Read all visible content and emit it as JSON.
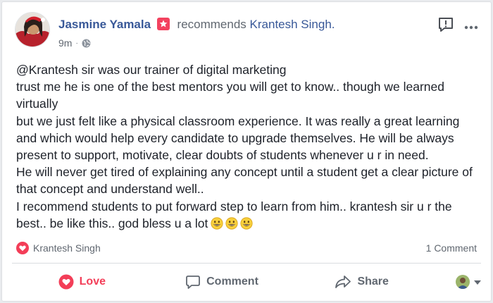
{
  "post": {
    "author": "Jasmine Yamala",
    "action": "recommends",
    "target": "Krantesh Singh.",
    "time": "9m",
    "lines": [
      "@Krantesh sir was our trainer of digital marketing",
      "trust me he is one of the best mentors you will get to know.. though we learned virtually",
      "but we just felt like a physical classroom experience. It was really a great learning and which would help every candidate to upgrade themselves. He will be always present to support, motivate, clear doubts of students whenever u r in need.",
      "He will never get tired of explaining any concept until a student get a clear picture of that concept and understand well..",
      "I recommend students to put forward step to learn from him.. krantesh sir u r the best.. be like this.. god bless u a lot"
    ],
    "emoji_count": 3
  },
  "reactions": {
    "reactor_name": "Krantesh Singh",
    "comment_count": "1 Comment"
  },
  "actions": {
    "love_label": "Love",
    "comment_label": "Comment",
    "share_label": "Share"
  },
  "icons": {
    "recommend": "recommend-icon",
    "globe": "globe-icon",
    "report": "report-icon",
    "more": "more-options-icon",
    "heart": "heart-icon",
    "comment": "comment-icon",
    "share": "share-icon",
    "dropdown": "chevron-down-icon"
  },
  "colors": {
    "link": "#385898",
    "love": "#f33e58",
    "muted": "#606770"
  }
}
